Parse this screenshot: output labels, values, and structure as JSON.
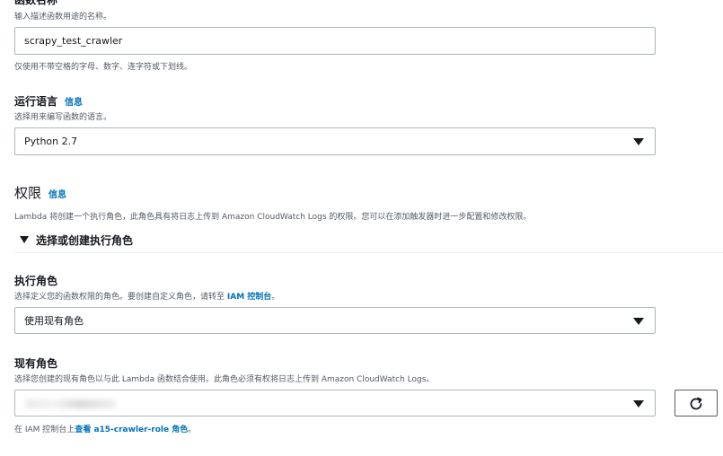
{
  "function_name": {
    "label_partial": "函数名称",
    "hint": "输入描述函数用途的名称。",
    "value": "scrapy_test_crawler",
    "constraint": "仅使用不带空格的字母、数字、连字符或下划线。"
  },
  "runtime": {
    "label": "运行语言",
    "info": "信息",
    "hint": "选择用来编写函数的语言。",
    "selected": "Python 2.7"
  },
  "permissions": {
    "title": "权限",
    "info": "信息",
    "description": "Lambda 将创建一个执行角色，此角色具有将日志上传到 Amazon CloudWatch Logs 的权限。您可以在添加触发器时进一步配置和修改权限。",
    "toggle_label": "选择或创建执行角色"
  },
  "execution_role": {
    "label": "执行角色",
    "hint_prefix": "选择定义您的函数权限的角色。要创建自定义角色，请转至 ",
    "hint_link": "IAM 控制台",
    "hint_suffix": "。",
    "selected": "使用现有角色"
  },
  "existing_role": {
    "label": "现有角色",
    "hint": "选择您创建的现有角色以与此 Lambda 函数结合使用。此角色必须有权将日志上传到 Amazon CloudWatch Logs。",
    "footer_prefix": "在 IAM 控制台上",
    "footer_link": "查看 a15-crawler-role 角色",
    "footer_suffix": "。"
  },
  "icons": {
    "dropdown": "caret-down-icon",
    "refresh": "refresh-icon"
  },
  "colors": {
    "link": "#0073bb",
    "border": "#aab7b8",
    "text": "#16191f",
    "muted": "#545b64"
  }
}
